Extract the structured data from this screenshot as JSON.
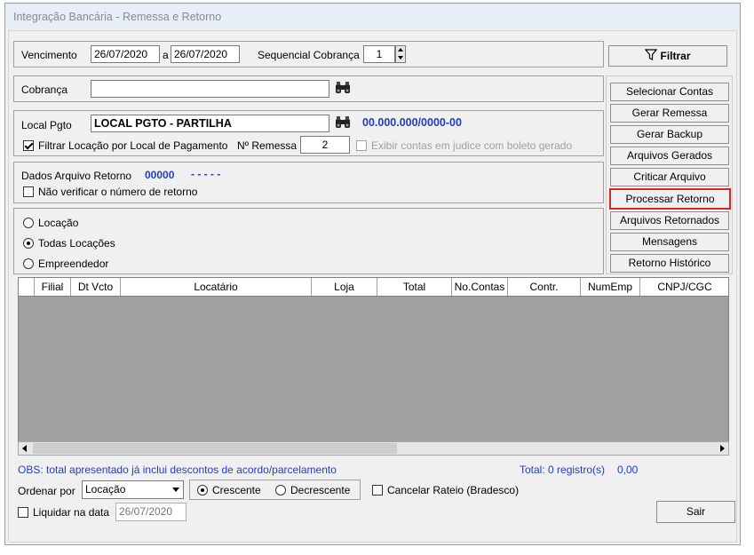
{
  "window": {
    "title": "Integração Bancária - Remessa e Retorno"
  },
  "filters": {
    "vencimento_label": "Vencimento",
    "date_from": "26/07/2020",
    "date_sep": "a",
    "date_to": "26/07/2020",
    "sequencial_label": "Sequencial Cobrança",
    "sequencial_value": "1",
    "filtrar_label": "Filtrar"
  },
  "cobranca": {
    "label": "Cobrança",
    "value": ""
  },
  "local": {
    "label": "Local Pgto",
    "value": "LOCAL PGTO - PARTILHA",
    "code": "00.000.000/0000-00",
    "filtrar_locacao_label": "Filtrar Locação por Local de Pagamento",
    "remessa_label": "Nº Remessa",
    "remessa_value": "2",
    "exibir_label": "Exibir contas em judice com boleto gerado"
  },
  "retorno": {
    "label": "Dados Arquivo Retorno",
    "number": "00000",
    "dashes": "- - - - -",
    "nao_verificar_label": "Não verificar o número de retorno"
  },
  "options": {
    "locacao": "Locação",
    "todas": "Todas Locações",
    "empreendedor": "Empreendedor"
  },
  "actions": [
    {
      "label": "Selecionar Contas"
    },
    {
      "label": "Gerar Remessa"
    },
    {
      "label": "Gerar Backup"
    },
    {
      "label": "Arquivos Gerados"
    },
    {
      "label": "Criticar Arquivo"
    },
    {
      "label": "Processar Retorno"
    },
    {
      "label": "Arquivos Retornados"
    },
    {
      "label": "Mensagens"
    },
    {
      "label": "Retorno Histórico"
    }
  ],
  "grid": {
    "columns": [
      "Filial",
      "Dt Vcto",
      "Locatário",
      "Loja",
      "Total",
      "No.Contas",
      "Contr.",
      "NumEmp",
      "CNPJ/CGC"
    ]
  },
  "footer": {
    "obs": "OBS: total apresentado já inclui descontos de acordo/parcelamento",
    "total_label": "Total: 0 registro(s)",
    "total_value": "0,00",
    "ordenar_label": "Ordenar por",
    "ordenar_value": "Locação",
    "crescente": "Crescente",
    "decrescente": "Decrescente",
    "cancelar_rateio": "Cancelar Rateio (Bradesco)",
    "liquidar_label": "Liquidar na data",
    "liquidar_date": "26/07/2020",
    "sair_label": "Sair"
  },
  "colors": {
    "accent_blue": "#1f3ec2",
    "highlight_red": "#d9262a"
  }
}
